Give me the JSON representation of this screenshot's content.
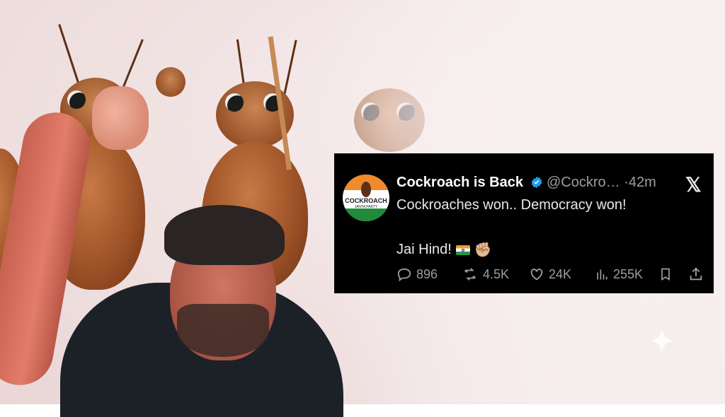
{
  "tweet": {
    "account_name": "Cockroach is Back",
    "handle": "@Cockro…",
    "time": "·42m",
    "text_line1": "Cockroaches won.. Democracy won!",
    "text_line2": "Jai Hind!",
    "avatar_text_main": "COCKROACH",
    "avatar_text_sub": "JANTA PARTY",
    "replies": "896",
    "reposts": "4.5K",
    "likes": "24K",
    "views": "255K",
    "platform_logo": "𝕏"
  },
  "colors": {
    "tweet_bg": "#000000",
    "verified_badge": "#1d9bf0",
    "muted_text": "#9a9ea3"
  }
}
